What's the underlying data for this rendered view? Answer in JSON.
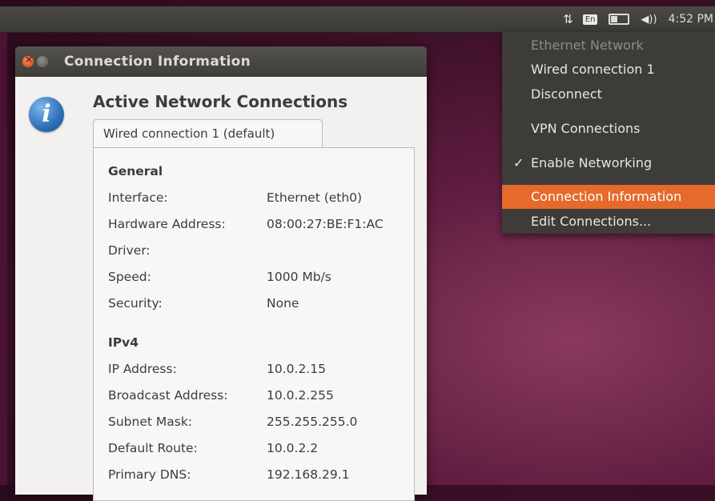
{
  "top_panel": {
    "keyboard_layout": "En",
    "clock": "4:52 PM",
    "icons": [
      "network-updown-icon",
      "battery-icon",
      "volume-icon"
    ]
  },
  "dialog": {
    "title": "Connection Information",
    "heading": "Active Network Connections",
    "tab_label": "Wired connection 1 (default)",
    "general": {
      "title": "General",
      "rows": [
        {
          "key": "Interface:",
          "value": "Ethernet (eth0)"
        },
        {
          "key": "Hardware Address:",
          "value": "08:00:27:BE:F1:AC"
        },
        {
          "key": "Driver:",
          "value": ""
        },
        {
          "key": "Speed:",
          "value": "1000 Mb/s"
        },
        {
          "key": "Security:",
          "value": "None"
        }
      ]
    },
    "ipv4": {
      "title": "IPv4",
      "rows": [
        {
          "key": "IP Address:",
          "value": "10.0.2.15"
        },
        {
          "key": "Broadcast Address:",
          "value": "10.0.2.255"
        },
        {
          "key": "Subnet Mask:",
          "value": "255.255.255.0"
        },
        {
          "key": "Default Route:",
          "value": "10.0.2.2"
        },
        {
          "key": "Primary DNS:",
          "value": "192.168.29.1"
        }
      ]
    }
  },
  "network_menu": {
    "items": [
      {
        "label": "Ethernet Network"
      },
      {
        "label": "Wired connection 1"
      },
      {
        "label": "Disconnect"
      },
      {
        "label": "VPN Connections"
      },
      {
        "label": "Enable Networking"
      },
      {
        "label": "Connection Information"
      },
      {
        "label": "Edit Connections..."
      }
    ],
    "accent_color": "#e56a2b"
  }
}
